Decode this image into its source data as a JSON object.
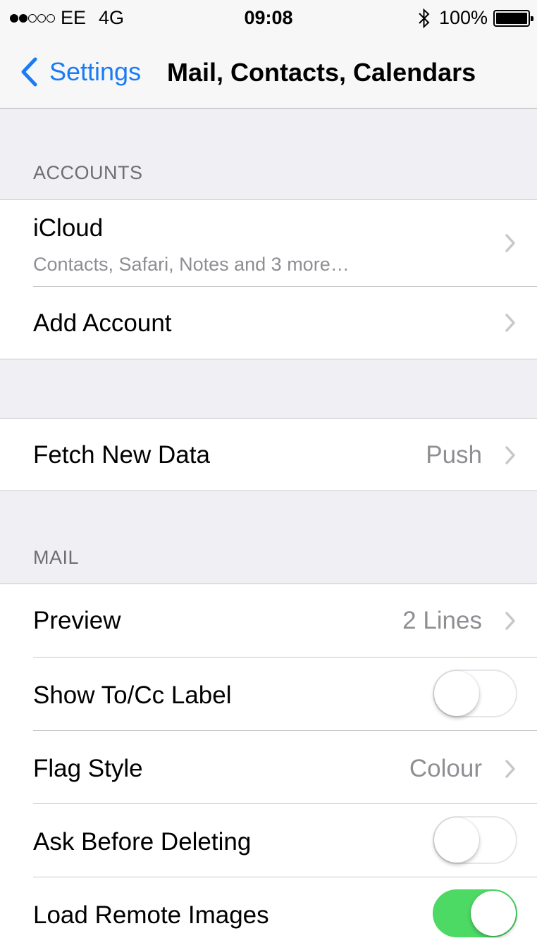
{
  "status": {
    "carrier": "EE",
    "network": "4G",
    "time": "09:08",
    "battery": "100%",
    "signal_bars_filled": 2,
    "signal_bars_total": 5
  },
  "nav": {
    "back_label": "Settings",
    "title": "Mail, Contacts, Calendars",
    "accent": "#1a7cf5"
  },
  "sections": {
    "accounts_header": "ACCOUNTS",
    "mail_header": "MAIL"
  },
  "accounts": {
    "icloud": {
      "label": "iCloud",
      "detail": "Contacts, Safari, Notes and 3 more…"
    },
    "add_account": {
      "label": "Add Account"
    }
  },
  "fetch": {
    "label": "Fetch New Data",
    "value": "Push"
  },
  "mail": {
    "preview": {
      "label": "Preview",
      "value": "2 Lines"
    },
    "show_to_cc": {
      "label": "Show To/Cc Label",
      "on": false
    },
    "flag_style": {
      "label": "Flag Style",
      "value": "Colour"
    },
    "ask_before_deleting": {
      "label": "Ask Before Deleting",
      "on": false
    },
    "load_remote_images": {
      "label": "Load Remote Images",
      "on": true
    }
  },
  "colors": {
    "toggle_on": "#4cd964",
    "background": "#efeff4"
  }
}
